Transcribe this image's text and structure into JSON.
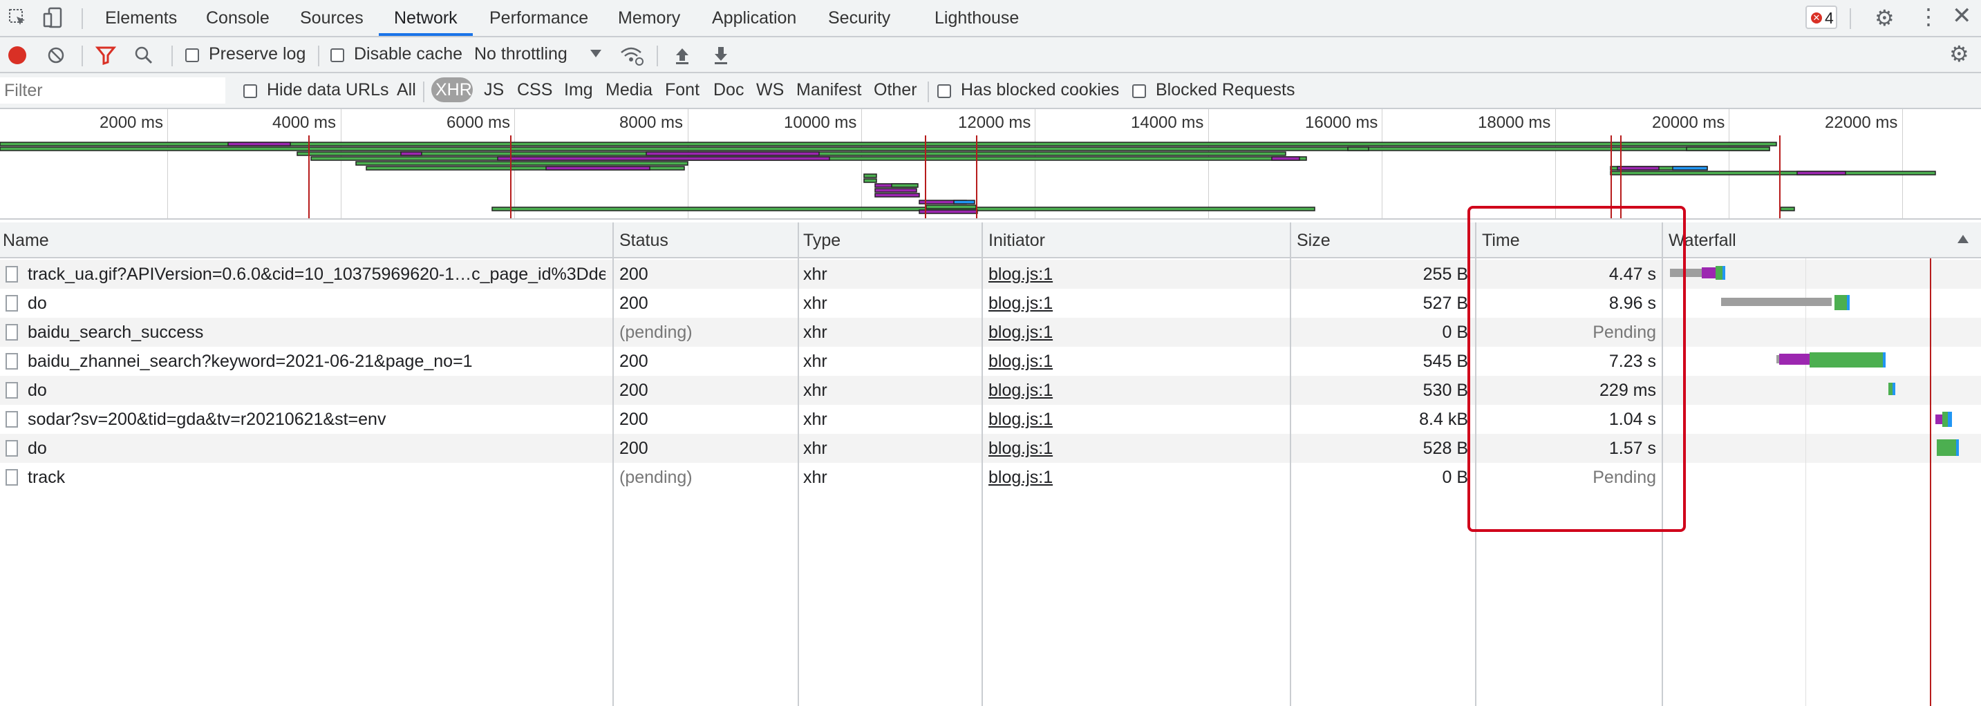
{
  "tabs": [
    "Elements",
    "Console",
    "Sources",
    "Network",
    "Performance",
    "Memory",
    "Application",
    "Security",
    "Lighthouse"
  ],
  "error_count": "4",
  "toolbar": {
    "preserve_log": "Preserve log",
    "disable_cache": "Disable cache",
    "throttling": "No throttling"
  },
  "filter": {
    "placeholder": "Filter",
    "hide_data_urls": "Hide data URLs",
    "types": [
      "All",
      "XHR",
      "JS",
      "CSS",
      "Img",
      "Media",
      "Font",
      "Doc",
      "WS",
      "Manifest",
      "Other"
    ],
    "selected_type": "XHR",
    "has_blocked_cookies": "Has blocked cookies",
    "blocked_requests": "Blocked Requests"
  },
  "overview": {
    "ticks": [
      "2000 ms",
      "4000 ms",
      "6000 ms",
      "8000 ms",
      "10000 ms",
      "12000 ms",
      "14000 ms",
      "16000 ms",
      "18000 ms",
      "20000 ms",
      "22000 ms"
    ]
  },
  "columns": {
    "name": "Name",
    "status": "Status",
    "type": "Type",
    "initiator": "Initiator",
    "size": "Size",
    "time": "Time",
    "waterfall": "Waterfall"
  },
  "rows": [
    {
      "name": "track_ua.gif?APIVersion=0.6.0&cid=10_10375969620-1…c_page_id%3Dde…",
      "status": "200",
      "type": "xhr",
      "initiator": "blog.js:1",
      "size": "255 B",
      "time": "4.47 s"
    },
    {
      "name": "do",
      "status": "200",
      "type": "xhr",
      "initiator": "blog.js:1",
      "size": "527 B",
      "time": "8.96 s"
    },
    {
      "name": "baidu_search_success",
      "status": "(pending)",
      "type": "xhr",
      "initiator": "blog.js:1",
      "size": "0 B",
      "time": "Pending"
    },
    {
      "name": "baidu_zhannei_search?keyword=2021-06-21&page_no=1",
      "status": "200",
      "type": "xhr",
      "initiator": "blog.js:1",
      "size": "545 B",
      "time": "7.23 s"
    },
    {
      "name": "do",
      "status": "200",
      "type": "xhr",
      "initiator": "blog.js:1",
      "size": "530 B",
      "time": "229 ms"
    },
    {
      "name": "sodar?sv=200&tid=gda&tv=r20210621&st=env",
      "status": "200",
      "type": "xhr",
      "initiator": "blog.js:1",
      "size": "8.4 kB",
      "time": "1.04 s"
    },
    {
      "name": "do",
      "status": "200",
      "type": "xhr",
      "initiator": "blog.js:1",
      "size": "528 B",
      "time": "1.57 s"
    },
    {
      "name": "track",
      "status": "(pending)",
      "type": "xhr",
      "initiator": "blog.js:1",
      "size": "0 B",
      "time": "Pending"
    }
  ],
  "colors": {
    "accent": "#1a73e8",
    "highlight": "#d0021b",
    "record": "#d93025",
    "waiting": "#9c27b0",
    "download": "#4caf50",
    "stalled": "#9e9e9e"
  }
}
